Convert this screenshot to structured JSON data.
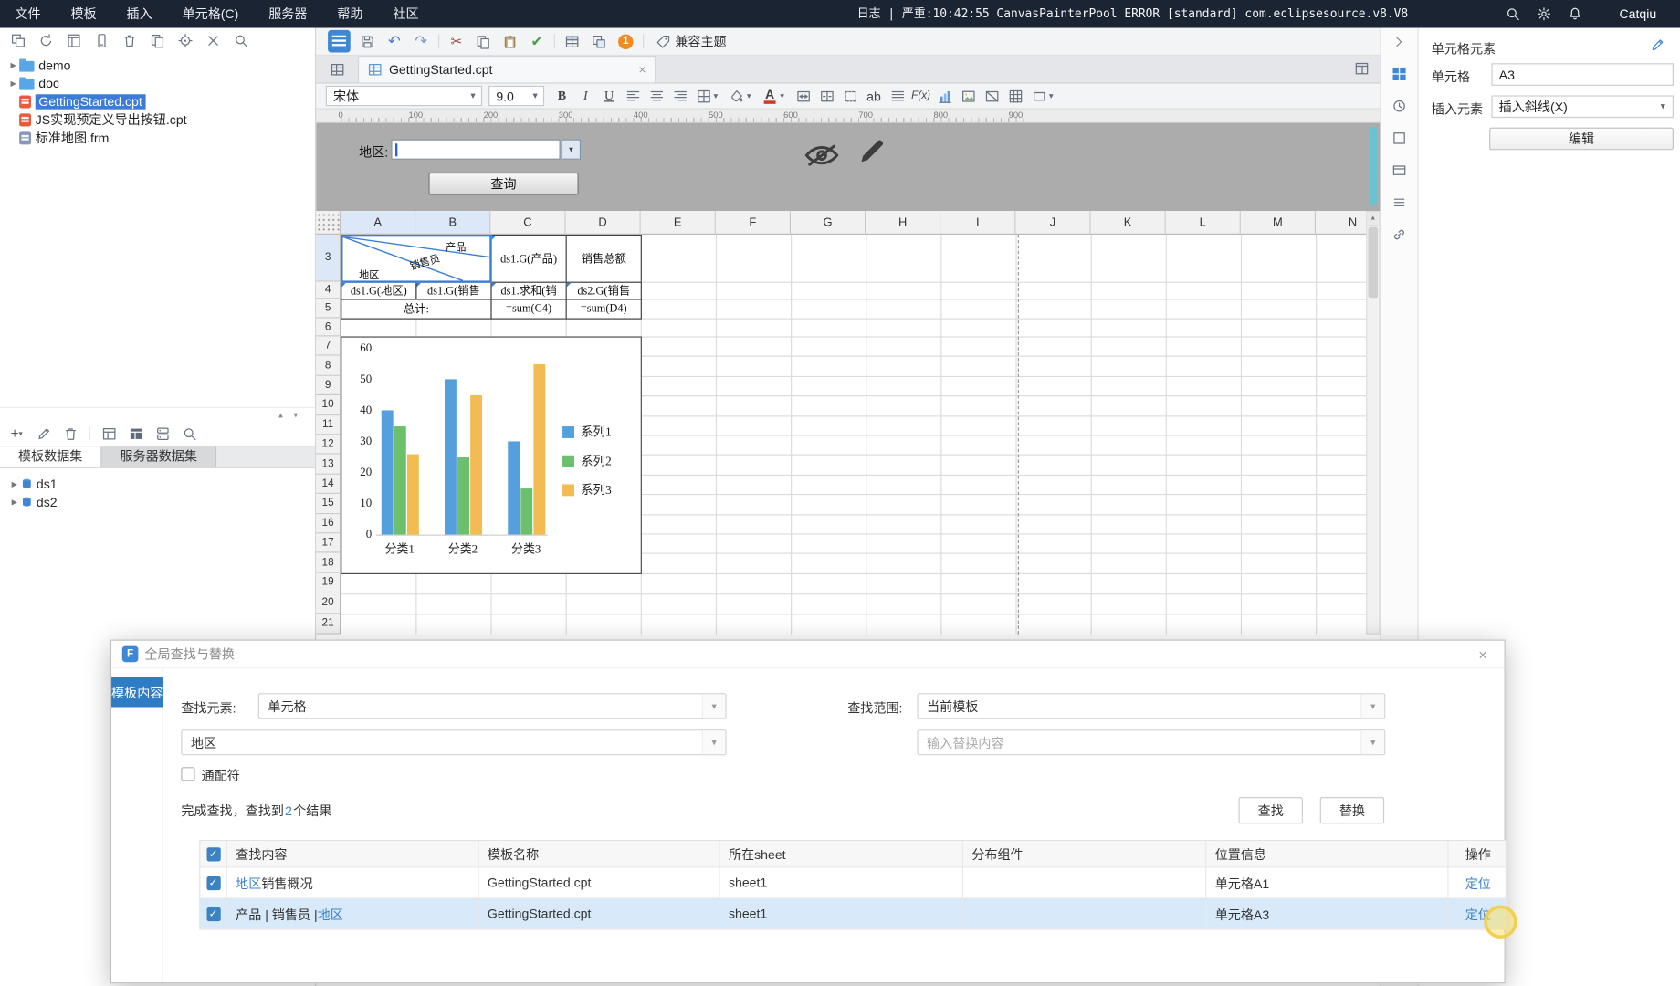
{
  "glyphs": {
    "caret_down": "▾",
    "caret_up": "▴",
    "expander": "▶",
    "close": "×",
    "check": "✓",
    "up_arrow": "▲",
    "undo": "↶",
    "redo": "↷",
    "cut": "✂",
    "brush_check": "✔",
    "plus": "+"
  },
  "colors": {
    "accent": "#3b7fd4",
    "selection": "#3c7cd8",
    "row_highlight": "#d8eafa",
    "series1": "#55a0dc",
    "series2": "#6cbf6c",
    "series3": "#f2bc52"
  },
  "menubar": {
    "items": [
      "文件",
      "模板",
      "插入",
      "单元格(C)",
      "服务器",
      "帮助",
      "社区"
    ],
    "log_text": "日志 | 严重:10:42:55 CanvasPainterPool ERROR [standard] com.eclipsesource.v8.V8",
    "username": "Catqiu"
  },
  "left_panel": {
    "tree": [
      {
        "label": "demo",
        "type": "folder"
      },
      {
        "label": "doc",
        "type": "folder"
      },
      {
        "label": "GettingStarted.cpt",
        "type": "cpt",
        "selected": true
      },
      {
        "label": "JS实现预定义导出按钮.cpt",
        "type": "cpt"
      },
      {
        "label": "标准地图.frm",
        "type": "frm"
      }
    ],
    "dataset_tabs": [
      {
        "label": "模板数据集",
        "active": true
      },
      {
        "label": "服务器数据集",
        "active": false
      }
    ],
    "datasets": [
      {
        "label": "ds1"
      },
      {
        "label": "ds2"
      }
    ]
  },
  "main_toolbar": {
    "icons": [
      "template-version",
      "save",
      "undo",
      "redo",
      "sep",
      "cut",
      "copy-cell",
      "paste",
      "format-brush",
      "sep",
      "insert-cell-element",
      "insert-float-element",
      "message-badge",
      "sep"
    ],
    "badge_text": "1",
    "theme_label": "兼容主题"
  },
  "doc_tab": {
    "label": "GettingStarted.cpt"
  },
  "format_toolbar": {
    "font_family": "宋体",
    "font_size": "9.0",
    "labels": {
      "bold": "B",
      "italic": "I",
      "underline": "U",
      "text_ab": "ab",
      "formula": "F(x)"
    },
    "buttons": [
      "bold",
      "italic",
      "underline",
      "align-left",
      "align-center",
      "align-right",
      "border",
      "fill-color",
      "font-color",
      "merge-cells",
      "split-cells",
      "insert-widget",
      "text-ab",
      "justify",
      "formula",
      "insert-chart",
      "insert-image",
      "insert-slash",
      "insert-grid",
      "insert-shape"
    ]
  },
  "ruler": {
    "marks": [
      "0",
      "100",
      "200",
      "300",
      "400",
      "500",
      "600",
      "700",
      "800",
      "900"
    ]
  },
  "param_pane": {
    "label": "地区:",
    "query_button": "查询"
  },
  "grid": {
    "col_headers": [
      "A",
      "B",
      "C",
      "D",
      "E",
      "F",
      "G",
      "H",
      "I",
      "J",
      "K",
      "L",
      "M",
      "N"
    ],
    "row_headers": [
      "3",
      "4",
      "5",
      "6",
      "7",
      "8",
      "9",
      "10",
      "11",
      "12",
      "13",
      "14",
      "15",
      "16",
      "17",
      "18",
      "19",
      "20",
      "21"
    ],
    "diagonal_cell": {
      "top": "产品",
      "middle": "销售员",
      "bottom": "地区"
    },
    "cells": {
      "c3": "ds1.G(产品)",
      "d3": "销售总额",
      "a4": "ds1.G(地区)",
      "b4": "ds1.G(销售",
      "c4": "ds1.求和(销",
      "d4": "ds2.G(销售",
      "a5": "总计:",
      "c5": "=sum(C4)",
      "d5": "=sum(D4)"
    }
  },
  "chart_data": {
    "type": "bar",
    "title": "",
    "categories": [
      "分类1",
      "分类2",
      "分类3"
    ],
    "series": [
      {
        "name": "系列1",
        "color": "#55a0dc",
        "values": [
          40,
          50,
          30
        ]
      },
      {
        "name": "系列2",
        "color": "#6cbf6c",
        "values": [
          35,
          25,
          15
        ]
      },
      {
        "name": "系列3",
        "color": "#f2bc52",
        "values": [
          26,
          45,
          55
        ]
      }
    ],
    "ylim": [
      0,
      60
    ],
    "yticks": [
      0,
      10,
      20,
      30,
      40,
      50,
      60
    ],
    "xlabel": "",
    "ylabel": "",
    "grid": false,
    "legend_position": "right"
  },
  "dialog": {
    "title": "全局查找与替换",
    "logo_letter": "F",
    "tab": "模板内容",
    "find_element_label": "查找元素:",
    "find_element_value": "单元格",
    "find_scope_label": "查找范围:",
    "find_scope_value": "当前模板",
    "find_content_value": "地区",
    "replace_placeholder": "输入替换内容",
    "wildcard_label": "通配符",
    "result_text_prefix": "完成查找，查找到",
    "result_count": "2",
    "result_text_suffix": "个结果",
    "find_button": "查找",
    "replace_button": "替换",
    "table": {
      "headers": [
        "查找内容",
        "模板名称",
        "所在sheet",
        "分布组件",
        "位置信息",
        "操作"
      ],
      "rows": [
        {
          "content_parts": [
            {
              "text": "地区",
              "link": true
            },
            {
              "text": "销售概况",
              "link": false
            }
          ],
          "template": "GettingStarted.cpt",
          "sheet": "sheet1",
          "component": "",
          "position": "单元格A1",
          "action": "定位",
          "highlighted": false
        },
        {
          "content_parts": [
            {
              "text": "产品 | 销售员 | ",
              "link": false
            },
            {
              "text": "地区",
              "link": true
            }
          ],
          "template": "GettingStarted.cpt",
          "sheet": "sheet1",
          "component": "",
          "position": "单元格A3",
          "action": "定位",
          "highlighted": true
        }
      ]
    }
  },
  "right_panel": {
    "title": "单元格元素",
    "cell_label": "单元格",
    "cell_value": "A3",
    "insert_label": "插入元素",
    "insert_value": "插入斜线(X)",
    "edit_button": "编辑"
  }
}
